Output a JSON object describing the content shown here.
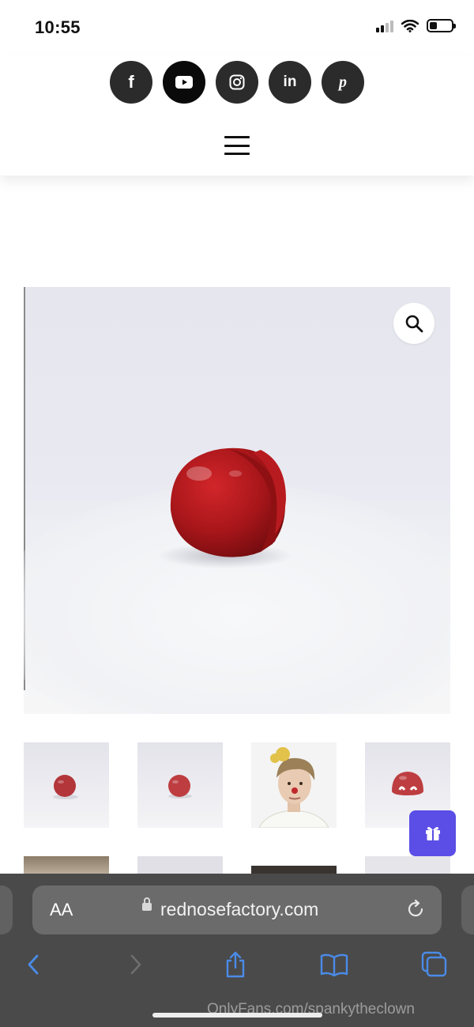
{
  "status_bar": {
    "time": "10:55",
    "icons": [
      "signal-icon",
      "wifi-icon",
      "battery-icon"
    ]
  },
  "header": {
    "social_links": [
      {
        "name": "facebook-icon",
        "glyph": "f"
      },
      {
        "name": "youtube-icon",
        "glyph": "▶"
      },
      {
        "name": "instagram-icon",
        "glyph": ""
      },
      {
        "name": "linkedin-icon",
        "glyph": "in"
      },
      {
        "name": "pinterest-icon",
        "glyph": "p"
      }
    ],
    "menu_icon": "hamburger-menu-icon"
  },
  "product": {
    "zoom_icon": "magnifier-icon",
    "image": "red-clown-nose-photo",
    "thumbnails": [
      "red-nose-thumb",
      "red-nose-thumb",
      "person-with-red-nose-thumb",
      "red-nose-open-thumb"
    ]
  },
  "gift_button": {
    "icon": "gift-icon"
  },
  "browser": {
    "text_size_label": "AA",
    "url": "rednosefactory.com",
    "toolbar_icons": [
      "back-icon",
      "forward-icon",
      "share-icon",
      "bookmarks-icon",
      "tabs-icon"
    ]
  },
  "watermark": "OnlyFans.com/spankytheclown",
  "colors": {
    "social_bg": "#2b2b2b",
    "gift_bg": "#5a4ee6",
    "browser_bar": "#4a4a4a",
    "link_blue": "#4a8be8"
  }
}
